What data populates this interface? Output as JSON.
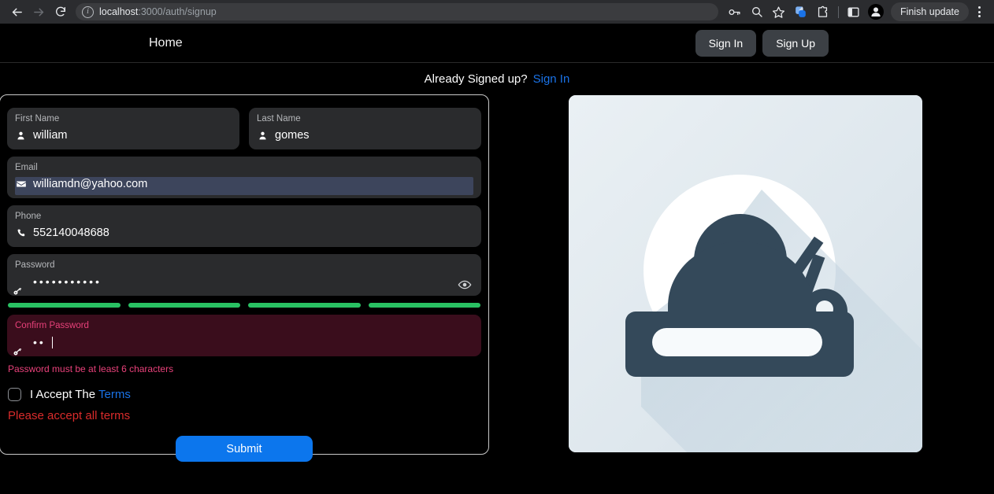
{
  "browser": {
    "back_icon": "back-arrow-icon",
    "forward_icon": "forward-arrow-icon",
    "reload_icon": "reload-icon",
    "site_info_icon": "site-info-icon",
    "url_host": "localhost",
    "url_path": ":3000/auth/signup",
    "toolbar_icons": [
      "password-key-icon",
      "zoom-search-icon",
      "bookmark-star-icon",
      "extension-blue-icon",
      "extensions-puzzle-icon",
      "side-panel-icon"
    ],
    "profile_icon": "profile-avatar-icon",
    "update_label": "Finish update",
    "menu_icon": "three-dot-menu-icon"
  },
  "header": {
    "home_label": "Home",
    "sign_in_label": "Sign In",
    "sign_up_label": "Sign Up"
  },
  "banner": {
    "text": "Already Signed up?",
    "link_label": "Sign In"
  },
  "form": {
    "first_name": {
      "label": "First Name",
      "value": "william",
      "icon": "person-icon"
    },
    "last_name": {
      "label": "Last Name",
      "value": "gomes",
      "icon": "person-icon"
    },
    "email": {
      "label": "Email",
      "value": "williamdn@yahoo.com",
      "icon": "envelope-icon"
    },
    "phone": {
      "label": "Phone",
      "value": "552140048688",
      "icon": "phone-icon"
    },
    "password": {
      "label": "Password",
      "value": "•••••••••••",
      "icon": "key-icon",
      "toggle_icon": "eye-icon",
      "strength_segments": 4,
      "strength_color": "#29c163"
    },
    "confirm_password": {
      "label": "Confirm Password",
      "value": "••",
      "icon": "key-icon",
      "error": "Password must be at least 6 characters"
    },
    "terms": {
      "checkbox_icon": "checkbox-unchecked-icon",
      "text": "I Accept The",
      "link_label": "Terms",
      "error": "Please accept all terms"
    },
    "submit_label": "Submit"
  },
  "illustration": {
    "name": "user-with-key-illustration",
    "figure_color": "#34495a",
    "circle_color": "#ffffff",
    "background_color": "#e2eaf0"
  }
}
